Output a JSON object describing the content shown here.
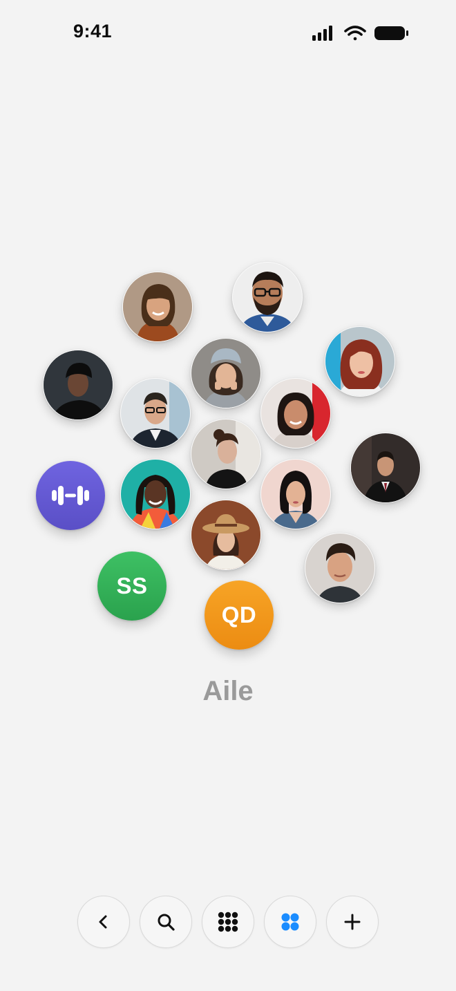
{
  "status_bar": {
    "time": "9:41"
  },
  "group": {
    "name": "Aile",
    "contacts": [
      {
        "type": "photo",
        "subject": "woman-bangs-brown-sweater"
      },
      {
        "type": "photo",
        "subject": "man-glasses-beard"
      },
      {
        "type": "photo",
        "subject": "woman-red-hair"
      },
      {
        "type": "photo",
        "subject": "man-black-beanie"
      },
      {
        "type": "photo",
        "subject": "woman-gray-beanie"
      },
      {
        "type": "photo",
        "subject": "man-glasses-blazer"
      },
      {
        "type": "photo",
        "subject": "woman-smiling-red-background"
      },
      {
        "type": "photo",
        "subject": "woman-black-turtleneck"
      },
      {
        "type": "photo",
        "subject": "man-suit-dark"
      },
      {
        "type": "icon",
        "icon": "dumbbell-icon",
        "color": "#6a5fd6"
      },
      {
        "type": "photo",
        "subject": "woman-braids-colorful"
      },
      {
        "type": "photo",
        "subject": "woman-straw-hat"
      },
      {
        "type": "photo",
        "subject": "woman-denim-jacket"
      },
      {
        "type": "photo",
        "subject": "young-man-smiling"
      },
      {
        "type": "initials",
        "text": "SS",
        "color": "#34b35a"
      },
      {
        "type": "initials",
        "text": "QD",
        "color": "#f2981d"
      }
    ]
  },
  "toolbar": {
    "buttons": [
      {
        "icon": "chevron-left-icon",
        "color": "#111111"
      },
      {
        "icon": "search-icon",
        "color": "#111111"
      },
      {
        "icon": "grid-nine-icon",
        "color": "#111111"
      },
      {
        "icon": "grid-four-icon",
        "color": "#1a8cff"
      },
      {
        "icon": "plus-icon",
        "color": "#111111"
      }
    ]
  }
}
